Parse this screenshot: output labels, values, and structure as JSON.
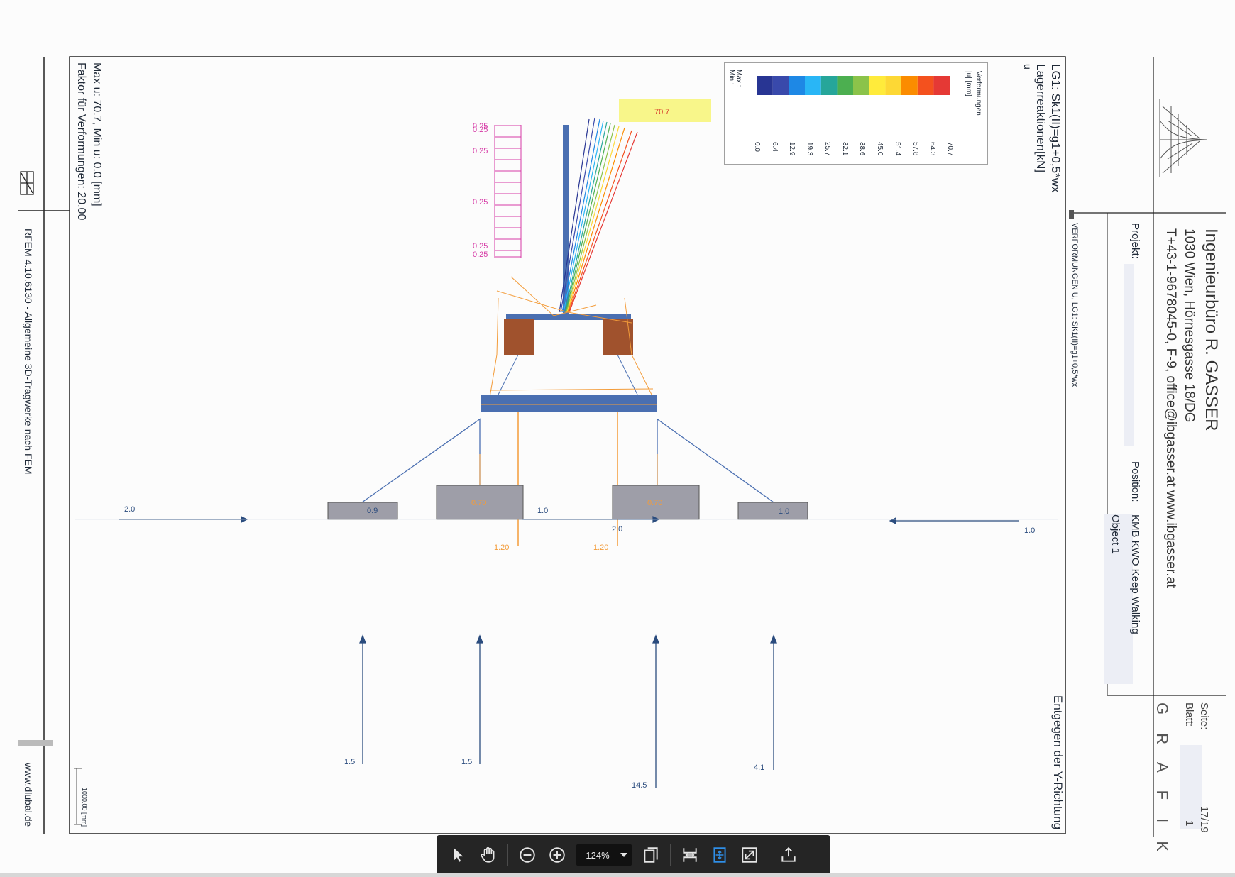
{
  "header": {
    "company": "Ingenieurbüro R. GASSER",
    "address": "1030 Wien, Hörnesgasse 18/DG",
    "contact": "T+43-1-9678045-0, F-9, office@ibgasser.at www.ibgasser.at",
    "projekt_label": "Projekt:",
    "position_label": "Position:",
    "position_value": "KMB KWO Keep Walking",
    "object_value": "Object 1",
    "seite_label": "Seite:",
    "seite_value": "17/19",
    "blatt_label": "Blatt:",
    "blatt_value": "1",
    "section": "G R A F I K"
  },
  "plot": {
    "title_line1": "LG1: Sk1(II)=g1+0,5*wx",
    "title_line2": "Lagerreaktionen[kN]",
    "title_line3": "u",
    "side_title": "VERFORMUNGEN U, LG1: SK1(II)=g1+0,5*wx",
    "direction": "Entgegen der Y-Richtung",
    "max_min": "Max u: 70.7, Min u: 0.0 [mm]",
    "faktor": "Faktor für Verformungen: 20.00",
    "scale": "1000.00 [mm]",
    "max_label": "70.7"
  },
  "legend": {
    "title": "Verformungen",
    "unit": "|u| [mm]",
    "values": [
      "70.7",
      "64.3",
      "57.8",
      "51.4",
      "45.0",
      "38.6",
      "32.1",
      "25.7",
      "19.3",
      "12.9",
      "6.4",
      "0.0"
    ],
    "colors": [
      "#e53935",
      "#f4511e",
      "#fb8c00",
      "#fdd835",
      "#ffeb3b",
      "#8bc34a",
      "#4caf50",
      "#26a69a",
      "#29b6f6",
      "#1e88e5",
      "#3949ab",
      "#283593"
    ],
    "max_label": "Max :",
    "min_label": "Min :",
    "max_value": "70.7",
    "min_value": "0.0"
  },
  "loads": {
    "wind": [
      "0.25",
      "0.25",
      "0.25",
      "0.25",
      "0.25",
      "0.25"
    ],
    "horizontal": [
      "2.0",
      "1.0",
      "2.0",
      "1.0"
    ],
    "block": [
      "0.9",
      "0.70",
      "0.70",
      "1.0"
    ],
    "orange": [
      "1.20",
      "1.20"
    ],
    "vertical": [
      "1.5",
      "1.5",
      "14.5",
      "4.1"
    ]
  },
  "footer": {
    "software": "RFEM 4.10.6130 - Allgemeine 3D-Tragwerke nach FEM",
    "website": "www.dlubal.de"
  },
  "toolbar": {
    "zoom": "124%",
    "icons": [
      "select-arrow-icon",
      "hand-icon",
      "zoom-out-icon",
      "zoom-in-icon",
      "pages-icon",
      "fit-width-icon",
      "fit-page-icon",
      "fullscreen-icon",
      "upload-icon"
    ]
  }
}
